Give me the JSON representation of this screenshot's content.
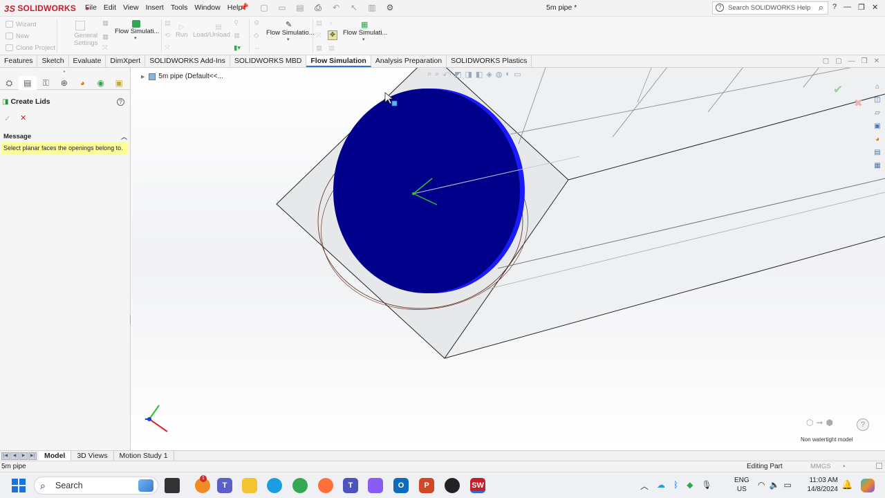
{
  "app": {
    "logo_text": "SOLIDWORKS",
    "logo_prefix": "3S",
    "menu": [
      "File",
      "Edit",
      "View",
      "Insert",
      "Tools",
      "Window",
      "Help"
    ],
    "doc_title": "5m pipe *",
    "search_placeholder": "Search SOLIDWORKS Help"
  },
  "command_manager": {
    "wizard": "Wizard",
    "new": "New",
    "clone_project": "Clone Project",
    "general": "General",
    "settings": "Settings",
    "flow_sim_1": "Flow Simulati...",
    "run": "Run",
    "load_unload": "Load/Unload",
    "flow_sim_2": "Flow Simulatio...",
    "flow_sim_3": "Flow Simulati..."
  },
  "tabs": {
    "items": [
      "Features",
      "Sketch",
      "Evaluate",
      "DimXpert",
      "SOLIDWORKS Add-Ins",
      "SOLIDWORKS MBD",
      "Flow Simulation",
      "Analysis Preparation",
      "SOLIDWORKS Plastics"
    ],
    "active": "Flow Simulation"
  },
  "property_manager": {
    "title": "Create Lids",
    "message_header": "Message",
    "message_text": "Select planar faces the openings belong to."
  },
  "viewport": {
    "tree_label": "5m pipe  (Default<<...",
    "watertight_label": "Non watertight model",
    "face_color": "#00008b",
    "face_edge_color": "#1a1aff"
  },
  "bottom_tabs": {
    "items": [
      "Model",
      "3D Views",
      "Motion Study 1"
    ],
    "active": "Model"
  },
  "status_bar": {
    "left": "5m pipe",
    "editing": "Editing Part",
    "units": "MMGS"
  },
  "taskbar": {
    "search": "Search",
    "lang_1": "ENG",
    "lang_2": "US",
    "time": "11:03 AM",
    "date": "14/8/2024",
    "notification_count": "1"
  },
  "colors": {
    "accent": "#2a6fd1",
    "brand": "#c41e2a",
    "message_bg": "#ffff99"
  }
}
